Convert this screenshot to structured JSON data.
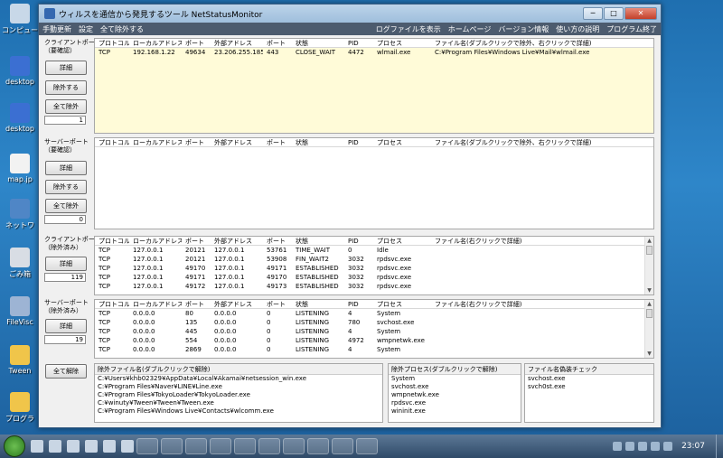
{
  "desktop_icons": [
    {
      "label": "コンピュー",
      "color": "#c8d8e8"
    },
    {
      "label": "desktop",
      "color": "#3b6fd2"
    },
    {
      "label": "desktop",
      "color": "#3b6fd2"
    },
    {
      "label": "map.jp",
      "color": "#f2f2f2"
    },
    {
      "label": "ネットワ",
      "color": "#4f86c6"
    },
    {
      "label": "ごみ箱",
      "color": "#d8dde4"
    },
    {
      "label": "FileVisc",
      "color": "#9db4d4"
    },
    {
      "label": "Tween",
      "color": "#f0c54a"
    },
    {
      "label": "プログラ",
      "color": "#f0c54a"
    }
  ],
  "window": {
    "title": "ウィルスを通信から発見するツール NetStatusMonitor",
    "controls": {
      "minimize": "─",
      "maximize": "□",
      "close": "✕"
    }
  },
  "menu": {
    "left": [
      "手動更新",
      "設定",
      "全て除外する"
    ],
    "right": [
      "ログファイルを表示",
      "ホームページ",
      "バージョン情報",
      "使い方の説明",
      "プログラム終了"
    ]
  },
  "sections": {
    "client_ports": {
      "label1": "クライアントポート",
      "label2": "（要確認）",
      "detail": "詳細",
      "exclude": "除外する",
      "exclude_all": "全て除外",
      "count": "1"
    },
    "server_ports": {
      "label1": "サーバーポート",
      "label2": "（要確認）",
      "detail": "詳細",
      "exclude": "除外する",
      "exclude_all": "全て除外",
      "count": "0"
    },
    "client_excluded": {
      "label1": "クライアントポート",
      "label2": "（除外済み）",
      "detail": "詳細",
      "count": "119"
    },
    "server_excluded": {
      "label1": "サーバーポート",
      "label2": "（除外済み）",
      "detail": "詳細",
      "count": "19"
    },
    "unexclude_all": "全て解除"
  },
  "headers": {
    "main": [
      "プロトコル",
      "ローカルアドレス",
      "ポート",
      "外部アドレス",
      "ポート",
      "状態",
      "PID",
      "プロセス",
      "ファイル名(ダブルクリックで除外、右クリックで詳細)"
    ],
    "excluded": [
      "プロトコル",
      "ローカルアドレス",
      "ポート",
      "外部アドレス",
      "ポート",
      "状態",
      "PID",
      "プロセス",
      "ファイル名(右クリックで詳細)"
    ]
  },
  "tables": {
    "client_check": [
      [
        "TCP",
        "192.168.1.22",
        "49634",
        "23.206.255.185",
        "443",
        "CLOSE_WAIT",
        "4472",
        "wlmail.exe",
        "C:¥Program Files¥Windows Live¥Mail¥wlmail.exe"
      ]
    ],
    "server_check": [],
    "client_excluded": [
      [
        "TCP",
        "127.0.0.1",
        "20121",
        "127.0.0.1",
        "53761",
        "TIME_WAIT",
        "0",
        "Idle",
        ""
      ],
      [
        "TCP",
        "127.0.0.1",
        "20121",
        "127.0.0.1",
        "53908",
        "FIN_WAIT2",
        "3032",
        "rpdsvc.exe",
        ""
      ],
      [
        "TCP",
        "127.0.0.1",
        "49170",
        "127.0.0.1",
        "49171",
        "ESTABLISHED",
        "3032",
        "rpdsvc.exe",
        ""
      ],
      [
        "TCP",
        "127.0.0.1",
        "49171",
        "127.0.0.1",
        "49170",
        "ESTABLISHED",
        "3032",
        "rpdsvc.exe",
        ""
      ],
      [
        "TCP",
        "127.0.0.1",
        "49172",
        "127.0.0.1",
        "49173",
        "ESTABLISHED",
        "3032",
        "rpdsvc.exe",
        ""
      ]
    ],
    "server_excluded": [
      [
        "TCP",
        "0.0.0.0",
        "80",
        "0.0.0.0",
        "0",
        "LISTENING",
        "4",
        "System",
        ""
      ],
      [
        "TCP",
        "0.0.0.0",
        "135",
        "0.0.0.0",
        "0",
        "LISTENING",
        "780",
        "svchost.exe",
        ""
      ],
      [
        "TCP",
        "0.0.0.0",
        "445",
        "0.0.0.0",
        "0",
        "LISTENING",
        "4",
        "System",
        ""
      ],
      [
        "TCP",
        "0.0.0.0",
        "554",
        "0.0.0.0",
        "0",
        "LISTENING",
        "4972",
        "wmpnetwk.exe",
        ""
      ],
      [
        "TCP",
        "0.0.0.0",
        "2869",
        "0.0.0.0",
        "0",
        "LISTENING",
        "4",
        "System",
        ""
      ]
    ]
  },
  "excluded_files": {
    "title": "除外ファイル名(ダブルクリックで解除)",
    "items": [
      "C:¥Users¥khb02329¥AppData¥Local¥Akamai¥netsession_win.exe",
      "C:¥Program Files¥Naver¥LINE¥Line.exe",
      "C:¥Program Files¥TokyoLoader¥TokyoLoader.exe",
      "C:¥winuty¥Tween¥Tween¥Tween.exe",
      "C:¥Program Files¥Windows Live¥Contacts¥wlcomm.exe"
    ]
  },
  "excluded_processes": {
    "title": "除外プロセス(ダブルクリックで解除)",
    "items": [
      "System",
      "svchost.exe",
      "wmpnetwk.exe",
      "rpdsvc.exe",
      "wininit.exe"
    ]
  },
  "spoof_check": {
    "title": "ファイル名偽装チェック",
    "items": [
      "svchost.exe",
      "svch0st.exe"
    ]
  },
  "taskbar": {
    "clock": "23:07"
  }
}
